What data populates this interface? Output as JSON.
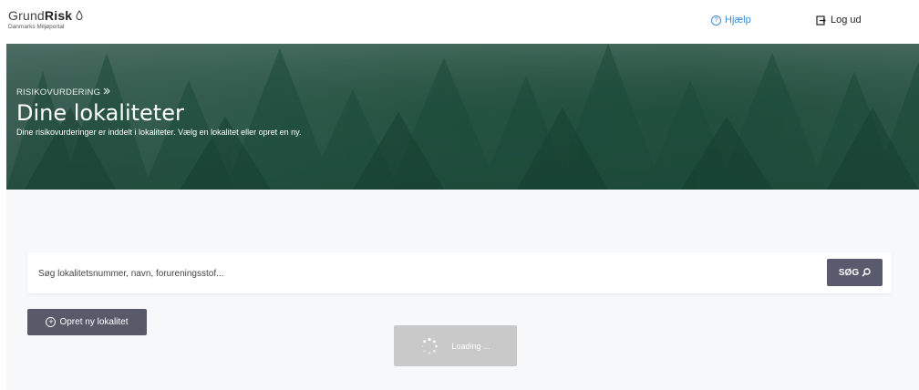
{
  "header": {
    "logo_prefix": "Grund",
    "logo_bold": "Risk",
    "logo_sub": "Danmarks Miljøportal",
    "help_label": "Hjælp",
    "logout_label": "Log ud",
    "accent_color": "#3c8cd0"
  },
  "hero": {
    "breadcrumb": "RISIKOVURDERING",
    "title": "Dine lokaliteter",
    "description": "Dine risikovurderinger er inddelt i lokaliteter. Vælg en lokalitet eller opret en ny."
  },
  "search": {
    "placeholder": "Søg lokalitetsnummer, navn, forureningsstof...",
    "value": "",
    "button_label": "SØG"
  },
  "actions": {
    "create_label": "Opret ny lokalitet"
  },
  "loading": {
    "label": "Loading ..."
  },
  "icons": [
    "drop-icon",
    "help-circle-icon",
    "logout-icon",
    "search-icon",
    "plus-circle-icon",
    "spinner-icon",
    "chevron-right-icon"
  ]
}
